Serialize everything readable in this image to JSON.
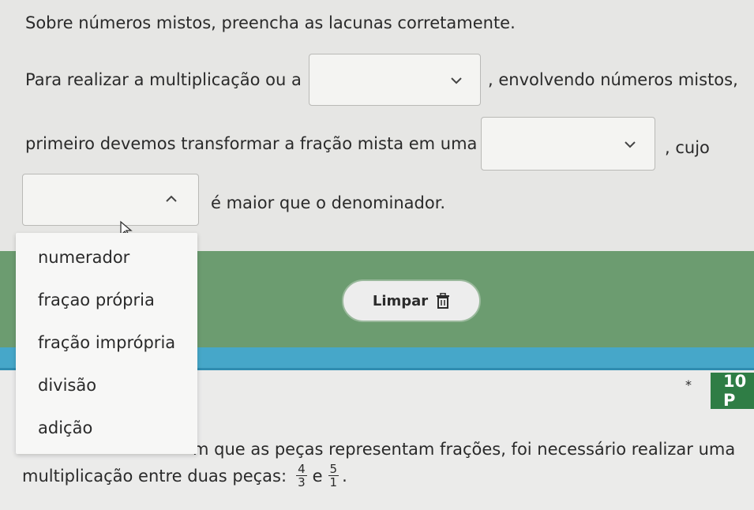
{
  "question": {
    "title": "Sobre números mistos, preencha as lacunas corretamente.",
    "line1_before": "Para realizar a multiplicação ou a",
    "line1_after": ", envolvendo números mistos,",
    "line2_before": "primeiro devemos transformar a fração mista em uma",
    "line2_after": ", cujo",
    "line3_after": "é maior que o denominador."
  },
  "dropdown_options": [
    "numerador",
    "fraçao própria",
    "fração imprópria",
    "divisão",
    "adição"
  ],
  "limpar_button": {
    "label": "Limpar"
  },
  "next_question": {
    "badge": "10 P",
    "star": "*",
    "line1": "m que as peças representam frações, foi necessário realizar uma",
    "line2_before": "multiplicação entre duas peças:",
    "frac1_num": "4",
    "frac1_den": "3",
    "connector": "e",
    "frac2_num": "5",
    "frac2_den": "1",
    "end": "."
  },
  "colors": {
    "green_band": "#6c9c70",
    "blue_band": "#46a7c9",
    "badge": "#2f7d45"
  }
}
